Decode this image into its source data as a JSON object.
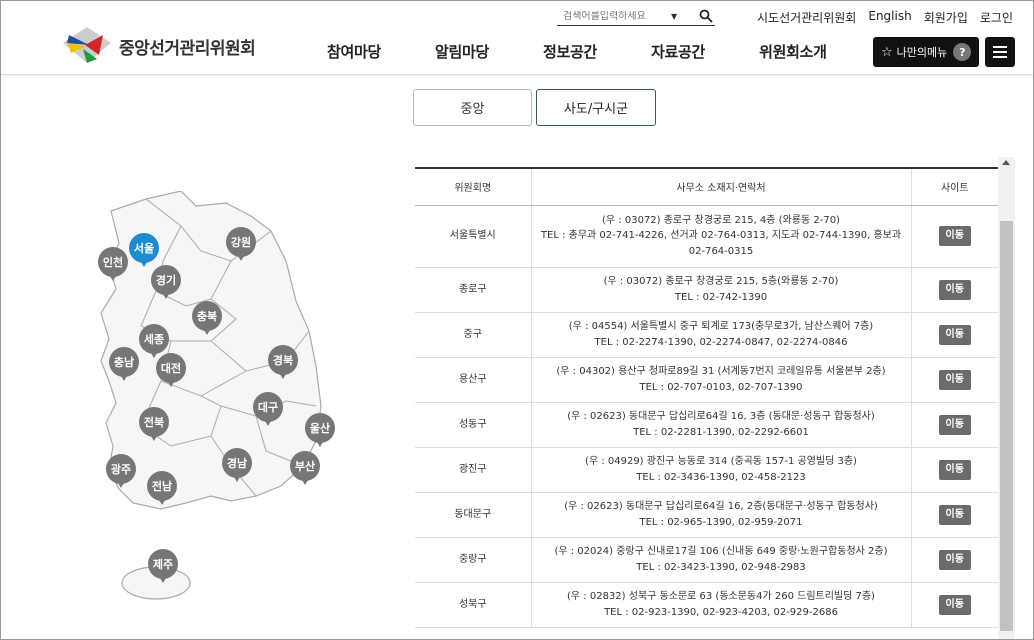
{
  "header": {
    "logo_text": "중앙선거관리위원회",
    "search_placeholder": "검색어를입력하세요",
    "top_links": [
      "시도선거관리위원회",
      "English",
      "회원가입",
      "로그인"
    ],
    "gnb": [
      "참여마당",
      "알림마당",
      "정보공간",
      "자료공간",
      "위원회소개"
    ],
    "mymenu_label": "나만의메뉴",
    "mymenu_help": "?"
  },
  "tabs": [
    "중앙",
    "사도/구시군"
  ],
  "map": {
    "active_color": "#1e8bd0",
    "pin_color": "#767676",
    "regions": [
      "서울",
      "인천",
      "경기",
      "강원",
      "충북",
      "세종",
      "충남",
      "대전",
      "경북",
      "대구",
      "울산",
      "전북",
      "경남",
      "부산",
      "광주",
      "전남",
      "제주"
    ]
  },
  "table": {
    "headers": [
      "위원회명",
      "사무소 소재지·연락처",
      "사이트"
    ],
    "button_label": "이동",
    "rows": [
      {
        "name": "서울특별시",
        "addr": "(우 : 03072) 종로구 창경궁로 215, 4층 (와룡동 2-70)",
        "tel": "TEL : 총무과 02-741-4226, 선거과 02-764-0313, 지도과 02-744-1390, 홍보과 02-764-0315"
      },
      {
        "name": "종로구",
        "addr": "(우 : 03072) 종로구 창경궁로 215, 5층(와룡동 2-70)",
        "tel": "TEL : 02-742-1390"
      },
      {
        "name": "중구",
        "addr": "(우 : 04554) 서울특별시 중구 퇴계로 173(충무로3가, 남산스퀘어 7층)",
        "tel": "TEL : 02-2274-1390, 02-2274-0847, 02-2274-0846"
      },
      {
        "name": "용산구",
        "addr": "(우 : 04302) 용산구 청파로89길 31 (서계동7번지 코레일유통 서울본부 2층)",
        "tel": "TEL : 02-707-0103, 02-707-1390"
      },
      {
        "name": "성동구",
        "addr": "(우 : 02623) 동대문구 답십리로64길 16, 3층 (동대문·성동구 합동청사)",
        "tel": "TEL : 02-2281-1390, 02-2292-6601"
      },
      {
        "name": "광진구",
        "addr": "(우 : 04929) 광진구 능동로 314 (중곡동 157-1 공영빌딩 3층)",
        "tel": "TEL : 02-3436-1390, 02-458-2123"
      },
      {
        "name": "동대문구",
        "addr": "(우 : 02623) 동대문구 답십리로64길 16, 2층(동대문구·성동구 합동청사)",
        "tel": "TEL : 02-965-1390, 02-959-2071"
      },
      {
        "name": "중랑구",
        "addr": "(우 : 02024) 중랑구 신내로17길 106 (신내동 649 중랑·노원구합동청사 2층)",
        "tel": "TEL : 02-3423-1390, 02-948-2983"
      },
      {
        "name": "성북구",
        "addr": "(우 : 02832) 성북구 동소문로 63 (동소문동4가 260 드림트리빌딩 7층)",
        "tel": "TEL : 02-923-1390, 02-923-4203, 02-929-2686"
      }
    ]
  }
}
